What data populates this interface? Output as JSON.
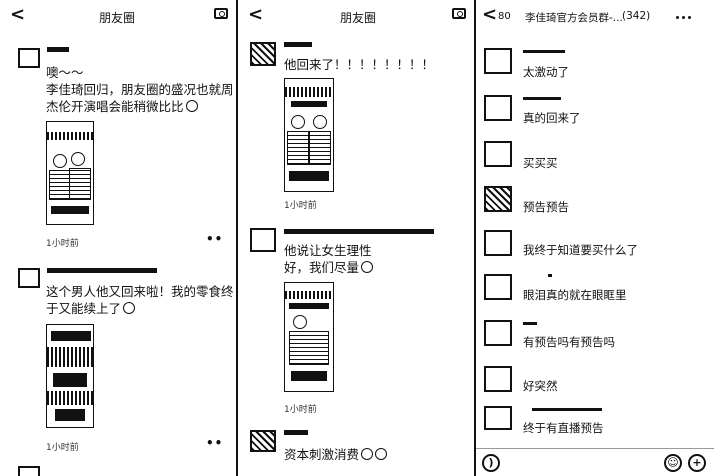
{
  "panel1": {
    "back": "<",
    "title": "朋友圈",
    "post1": {
      "line1": "噢～～",
      "line2": "李佳琦回归，朋友圈的盛况也就周",
      "line3": "杰伦开演唱会能稍微比比",
      "time": "1小时前",
      "more": "••"
    },
    "post2": {
      "line1": "这个男人他又回来啦！我的零食终",
      "line2": "于又能续上了",
      "time": "1小时前",
      "more": "••"
    }
  },
  "panel2": {
    "back": "<",
    "title": "朋友圈",
    "post1": {
      "text": "他回来了！！！！！！！！",
      "time": "1小时前"
    },
    "post2": {
      "line1": "他说让女生理性",
      "line2": "好，我们尽量",
      "time": "1小时前"
    },
    "post3": {
      "text": "资本刺激消费"
    }
  },
  "panel3": {
    "back": "<",
    "unread": "80",
    "title": "李佳琦官方会员群-...",
    "member_count": "(342)",
    "messages": [
      "太激动了",
      "真的回来了",
      "买买买",
      "预告预告",
      "我终于知道要买什么了",
      "眼泪真的就在眼眶里",
      "有预告吗有预告吗",
      "好突然",
      "终于有直播预告"
    ],
    "input_bar": {
      "voice": ")",
      "emoji": "☺",
      "plus": "+"
    }
  }
}
